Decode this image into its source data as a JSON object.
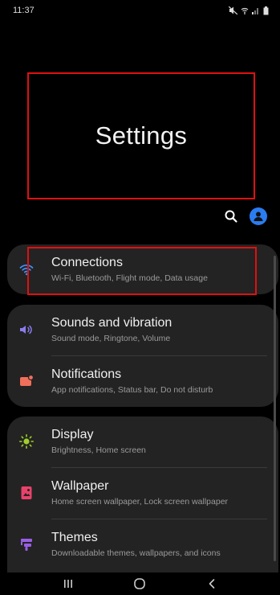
{
  "status_bar": {
    "time": "11:37"
  },
  "header": {
    "title": "Settings"
  },
  "actions": {
    "search_icon": "search-icon",
    "profile_icon": "profile-icon"
  },
  "items": [
    {
      "title": "Connections",
      "subtitle": "Wi-Fi, Bluetooth, Flight mode, Data usage",
      "icon": "wifi-icon",
      "color": "#3b8ff5"
    },
    {
      "title": "Sounds and vibration",
      "subtitle": "Sound mode, Ringtone, Volume",
      "icon": "volume-icon",
      "color": "#8a7cf0"
    },
    {
      "title": "Notifications",
      "subtitle": "App notifications, Status bar, Do not disturb",
      "icon": "notification-icon",
      "color": "#f06f5b"
    },
    {
      "title": "Display",
      "subtitle": "Brightness, Home screen",
      "icon": "sun-icon",
      "color": "#9fd02b"
    },
    {
      "title": "Wallpaper",
      "subtitle": "Home screen wallpaper, Lock screen wallpaper",
      "icon": "wallpaper-icon",
      "color": "#e9426a"
    },
    {
      "title": "Themes",
      "subtitle": "Downloadable themes, wallpapers, and icons",
      "icon": "themes-icon",
      "color": "#9a5ee6"
    }
  ],
  "nav_bar": {
    "recents": "recents-icon",
    "home": "home-icon",
    "back": "back-icon"
  }
}
